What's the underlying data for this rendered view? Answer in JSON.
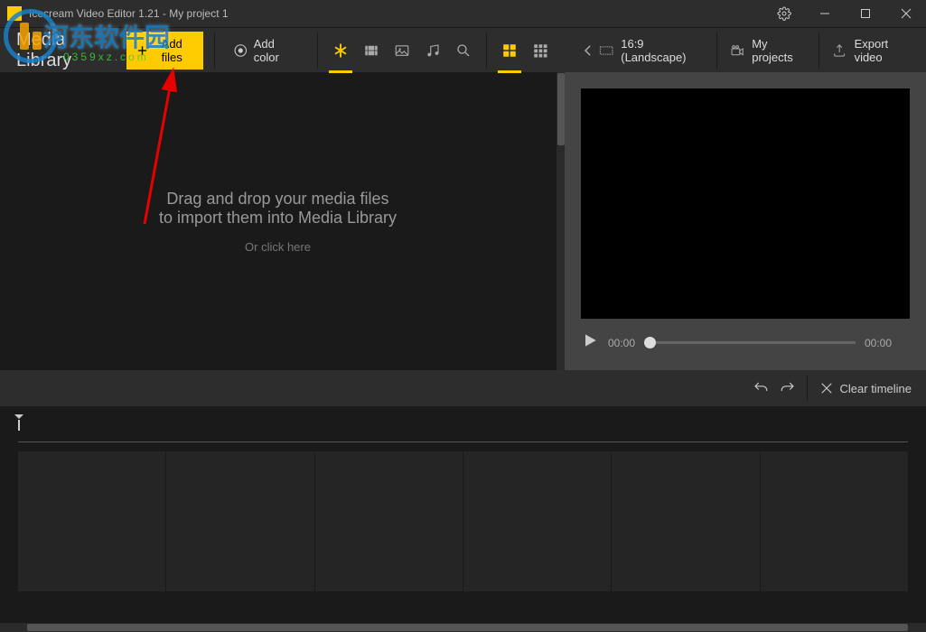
{
  "titlebar": {
    "text": "Icecream Video Editor 1.21 - My project 1"
  },
  "toolbar": {
    "section_title": "Media Library",
    "add_files": "Add files",
    "add_color": "Add color",
    "aspect": "16:9 (Landscape)",
    "my_projects": "My projects",
    "export": "Export video"
  },
  "library": {
    "drop_line1": "Drag and drop your media files",
    "drop_line2": "to import them into Media Library",
    "drop_line3": "Or click here"
  },
  "preview": {
    "current_time": "00:00",
    "total_time": "00:00"
  },
  "timeline": {
    "clear": "Clear timeline"
  },
  "watermark": {
    "text": "河东软件园",
    "sub": "0359xz.com"
  }
}
